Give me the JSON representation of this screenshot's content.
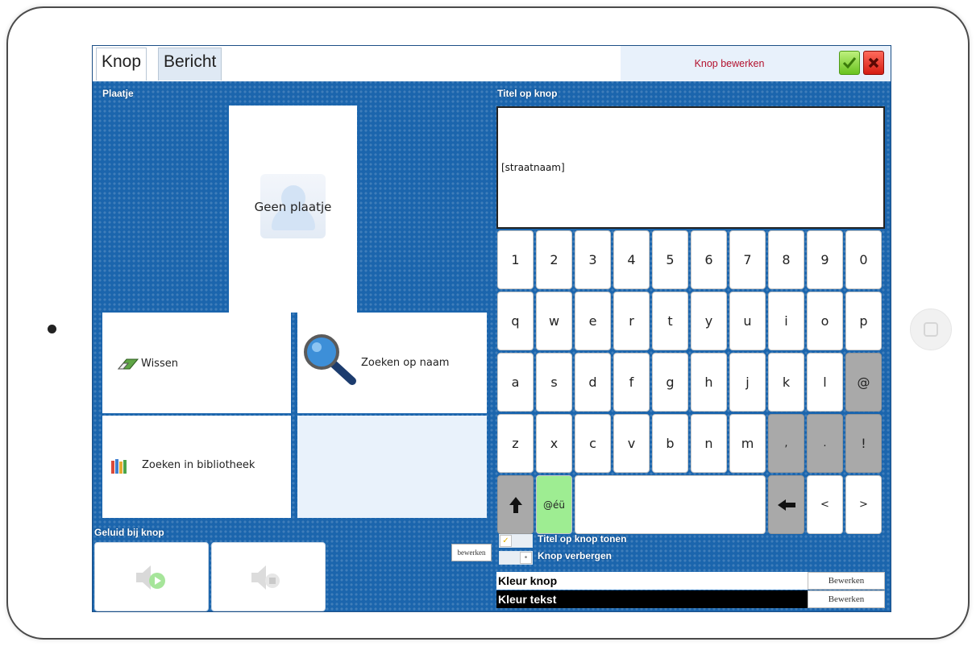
{
  "tabs": [
    {
      "label": "Knop",
      "active": true
    },
    {
      "label": "Bericht",
      "active": false
    }
  ],
  "header": {
    "title": "Knop bewerken",
    "ok_icon": "checkmark-icon",
    "cancel_icon": "close-x-icon",
    "title_color": "#b3122e"
  },
  "picture": {
    "section_label": "Plaatje",
    "placeholder_label": "Geen plaatje",
    "actions": {
      "clear_label": "Wissen",
      "search_name_label": "Zoeken op naam",
      "search_library_label": "Zoeken in bibliotheek"
    }
  },
  "sound": {
    "section_label": "Geluid bij knop",
    "play_icon": "speaker-play-icon",
    "stop_icon": "speaker-stop-icon",
    "edit_label": "bewerken"
  },
  "title_field": {
    "section_label": "Titel op knop",
    "value": "[straatnaam]"
  },
  "keyboard": {
    "rows": [
      [
        "1",
        "2",
        "3",
        "4",
        "5",
        "6",
        "7",
        "8",
        "9",
        "0"
      ],
      [
        "q",
        "w",
        "e",
        "r",
        "t",
        "y",
        "u",
        "i",
        "o",
        "p"
      ],
      [
        "a",
        "s",
        "d",
        "f",
        "g",
        "h",
        "j",
        "k",
        "l",
        "@"
      ],
      [
        "z",
        "x",
        "c",
        "v",
        "b",
        "n",
        "m",
        ",",
        ".",
        "!"
      ]
    ],
    "special_label": "@éü",
    "shift_icon": "arrow-up-icon",
    "backspace_icon": "arrow-left-icon",
    "less_than": "<",
    "greater_than": ">"
  },
  "options": [
    {
      "label": "Titel op knop tonen",
      "checked": true
    },
    {
      "label": "Knop verbergen",
      "checked": false
    }
  ],
  "colors": [
    {
      "label": "Kleur knop",
      "button": "Bewerken",
      "swatch": "#ffffff",
      "text_color": "#000000"
    },
    {
      "label": "Kleur tekst",
      "button": "Bewerken",
      "swatch": "#000000",
      "text_color": "#ffffff"
    }
  ],
  "theme": {
    "background": "#1b65ad",
    "special_key": "#9eed92",
    "gray_key": "#a9a9a9"
  }
}
